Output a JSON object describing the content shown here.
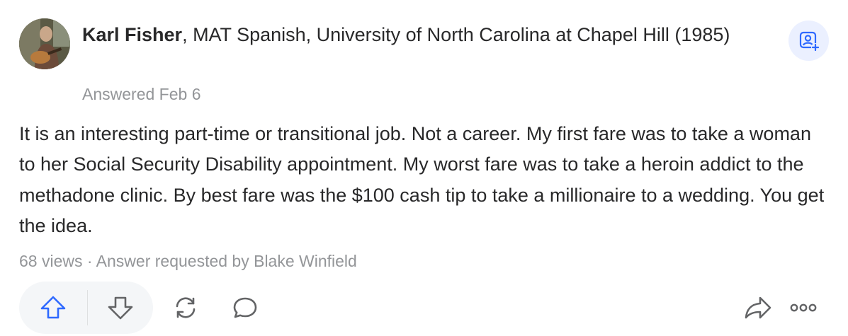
{
  "author": {
    "name": "Karl Fisher",
    "credential": ", MAT Spanish, University of North Carolina at Chapel Hill (1985)",
    "avatar_icon": "profile-photo"
  },
  "answered": "Answered Feb 6",
  "answer_text": "It is an interesting part-time or transitional job. Not a career. My first fare was to take a woman to her Social Security Disability appointment. My worst fare was to take a heroin addict to the methadone clinic. By best fare was the $100 cash tip to take a millionaire to a wedding. You get the idea.",
  "meta": "68 views · Answer requested by Blake Winfield",
  "actions": {
    "follow_icon": "follow-user-icon",
    "upvote_icon": "upvote-arrow-icon",
    "downvote_icon": "downvote-arrow-icon",
    "reshare_icon": "reshare-icon",
    "comment_icon": "comment-bubble-icon",
    "share_icon": "share-arrow-icon",
    "more_icon": "more-dots-icon"
  },
  "colors": {
    "accent": "#2e69ff",
    "text": "#282829",
    "muted": "#939598",
    "icon": "#636466"
  }
}
